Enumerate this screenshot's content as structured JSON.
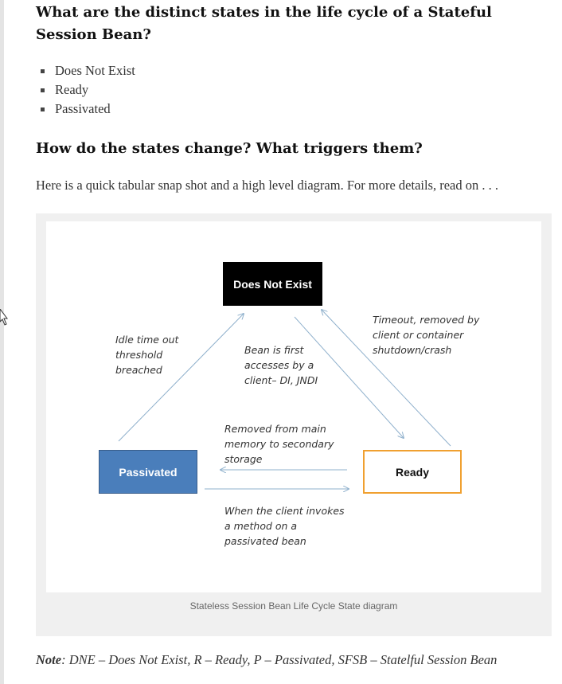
{
  "heading_states": "What are the distinct states in the life cycle of a Stateful Session Bean?",
  "states_list": [
    "Does Not Exist",
    "Ready",
    "Passivated"
  ],
  "heading_transitions": "How do the states change? What triggers them?",
  "intro_text": "Here is a quick tabular snap shot and a high level diagram. For more details, read on . . .",
  "diagram": {
    "states": {
      "does_not_exist": "Does Not Exist",
      "passivated": "Passivated",
      "ready": "Ready"
    },
    "labels": {
      "idle_timeout": "Idle time out\nthreshold\nbreached",
      "first_access": "Bean is first\naccesses by a\nclient– DI, JNDI",
      "timeout_removed": "Timeout, removed by\nclient or container\nshutdown/crash",
      "removed_memory": "Removed from main\nmemory to secondary\nstorage",
      "client_invokes": "When the client invokes\na method on a\npassivated bean"
    },
    "colors": {
      "does_not_exist_fill": "#000000",
      "passivated_fill": "#4a7ebb",
      "ready_border": "#f0a030",
      "arrow": "#8fb0cc"
    }
  },
  "caption": "Stateless Session Bean Life Cycle State diagram",
  "note": {
    "label": "Note",
    "text": ": DNE – Does Not Exist, R – Ready, P – Passivated, SFSB – Statelful Session Bean"
  }
}
